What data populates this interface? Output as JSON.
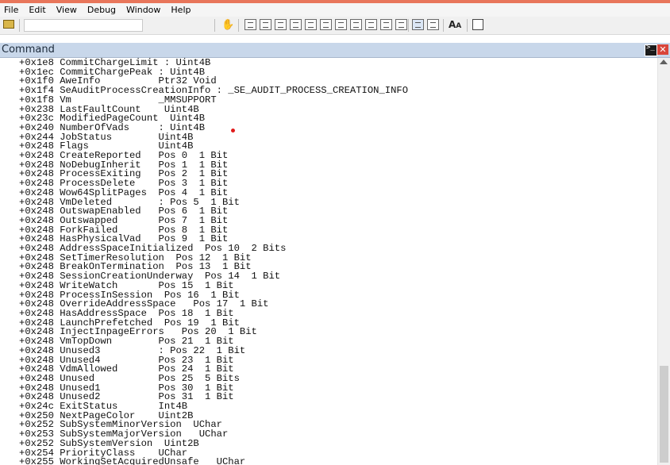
{
  "menu": {
    "items": [
      "File",
      "Edit",
      "View",
      "Debug",
      "Window",
      "Help"
    ]
  },
  "panel": {
    "title": "Command"
  },
  "icons": {
    "open": "folder-open-icon",
    "hand": "hand-icon",
    "font": "font-size-icon",
    "options": "options-icon",
    "command_window": "command-window-icon",
    "close": "close-icon"
  },
  "output_lines": [
    "+0x1e8 CommitChargeLimit : Uint4B",
    "+0x1ec CommitChargePeak : Uint4B",
    "+0x1f0 AweInfo          Ptr32 Void",
    "+0x1f4 SeAuditProcessCreationInfo : _SE_AUDIT_PROCESS_CREATION_INFO",
    "+0x1f8 Vm               _MMSUPPORT",
    "+0x238 LastFaultCount    Uint4B",
    "+0x23c ModifiedPageCount  Uint4B",
    "+0x240 NumberOfVads     : Uint4B",
    "+0x244 JobStatus        Uint4B",
    "+0x248 Flags            Uint4B",
    "+0x248 CreateReported   Pos 0  1 Bit",
    "+0x248 NoDebugInherit   Pos 1  1 Bit",
    "+0x248 ProcessExiting   Pos 2  1 Bit",
    "+0x248 ProcessDelete    Pos 3  1 Bit",
    "+0x248 Wow64SplitPages  Pos 4  1 Bit",
    "+0x248 VmDeleted        : Pos 5  1 Bit",
    "+0x248 OutswapEnabled   Pos 6  1 Bit",
    "+0x248 Outswapped       Pos 7  1 Bit",
    "+0x248 ForkFailed       Pos 8  1 Bit",
    "+0x248 HasPhysicalVad   Pos 9  1 Bit",
    "+0x248 AddressSpaceInitialized  Pos 10  2 Bits",
    "+0x248 SetTimerResolution  Pos 12  1 Bit",
    "+0x248 BreakOnTermination  Pos 13  1 Bit",
    "+0x248 SessionCreationUnderway  Pos 14  1 Bit",
    "+0x248 WriteWatch       Pos 15  1 Bit",
    "+0x248 ProcessInSession  Pos 16  1 Bit",
    "+0x248 OverrideAddressSpace   Pos 17  1 Bit",
    "+0x248 HasAddressSpace  Pos 18  1 Bit",
    "+0x248 LaunchPrefetched  Pos 19  1 Bit",
    "+0x248 InjectInpageErrors   Pos 20  1 Bit",
    "+0x248 VmTopDown        Pos 21  1 Bit",
    "+0x248 Unused3          : Pos 22  1 Bit",
    "+0x248 Unused4          Pos 23  1 Bit",
    "+0x248 VdmAllowed       Pos 24  1 Bit",
    "+0x248 Unused           Pos 25  5 Bits",
    "+0x248 Unused1          Pos 30  1 Bit",
    "+0x248 Unused2          Pos 31  1 Bit",
    "+0x24c ExitStatus       Int4B",
    "+0x250 NextPageColor    Uint2B",
    "+0x252 SubSystemMinorVersion  UChar",
    "+0x253 SubSystemMajorVersion   UChar",
    "+0x252 SubSystemVersion  Uint2B",
    "+0x254 PriorityClass    UChar",
    "+0x255 WorkingSetAcquiredUnsafe   UChar"
  ]
}
